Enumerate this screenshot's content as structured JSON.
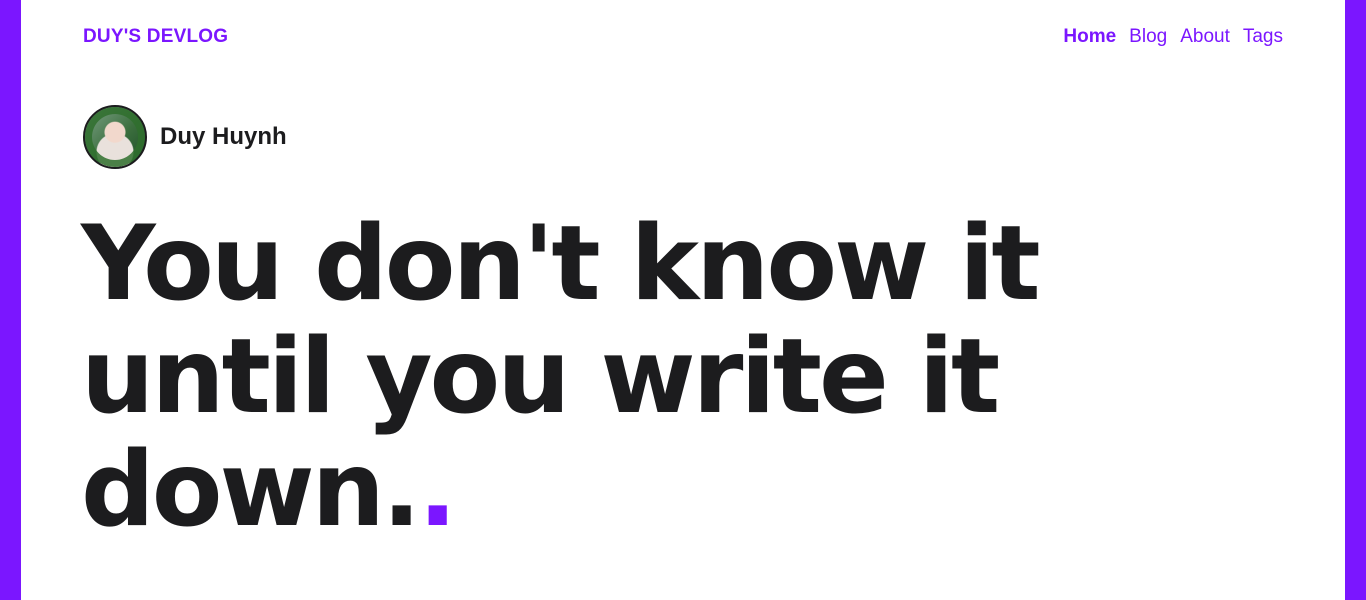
{
  "header": {
    "site_title": "DUY'S DEVLOG",
    "nav": [
      {
        "label": "Home",
        "active": true
      },
      {
        "label": "Blog",
        "active": false
      },
      {
        "label": "About",
        "active": false
      },
      {
        "label": "Tags",
        "active": false
      }
    ]
  },
  "author": {
    "name": "Duy Huynh",
    "avatar_icon": "avatar-photo"
  },
  "hero": {
    "line1": "You don't know it",
    "line2": "until you write it",
    "line3": "down.",
    "accent_dot": "."
  },
  "colors": {
    "accent": "#7b16ff",
    "text": "#1c1c1e",
    "background": "#ffffff"
  }
}
